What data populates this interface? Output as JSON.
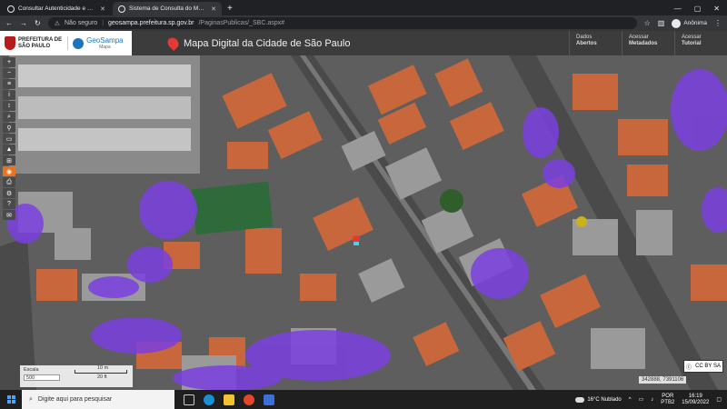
{
  "browser": {
    "tabs": [
      {
        "title": "Consultar Autenticidade e Valida",
        "active": false
      },
      {
        "title": "Sistema de Consulta do Mapa",
        "active": true
      }
    ],
    "new_tab": "+",
    "security": "Não seguro",
    "url_host": "geosampa.prefeitura.sp.gov.br",
    "url_path": "/PaginasPublicas/_SBC.aspx#",
    "profile": "Anônima"
  },
  "app": {
    "prefeitura": {
      "line1": "PREFEITURA DE",
      "line2": "SÃO PAULO"
    },
    "geosampa": {
      "name": "GeoSampa",
      "sub": "Mapa"
    },
    "title": "Mapa Digital da Cidade de São Paulo",
    "links": [
      {
        "line1": "Dados",
        "line2": "Abertos"
      },
      {
        "line1": "Acessar",
        "line2": "Metadados"
      },
      {
        "line1": "Acessar",
        "line2": "Tutorial"
      }
    ]
  },
  "map": {
    "scale": {
      "label": "Escala",
      "value": "500",
      "meters": "10 m",
      "feet": "20 ft"
    },
    "coordinates": "342888, 7391106",
    "license": "CC BY SA",
    "tools": [
      "+",
      "−",
      "≡",
      "i",
      "↕",
      "⌕",
      "⚲",
      "▭",
      "▲",
      "⊞",
      "◉",
      "⎙",
      "⚙",
      "?",
      "✉"
    ]
  },
  "taskbar": {
    "search_placeholder": "Digite aqui para pesquisar",
    "weather": "16°C Nublado",
    "lang": {
      "line1": "POR",
      "line2": "PTB2"
    },
    "clock": {
      "time": "16:19",
      "date": "15/09/2022"
    }
  }
}
